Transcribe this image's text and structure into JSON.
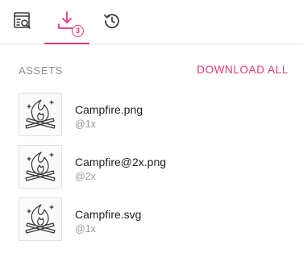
{
  "tabs": [
    {
      "icon": "inspect-icon"
    },
    {
      "icon": "download-icon",
      "badge": "3",
      "active": true
    },
    {
      "icon": "history-icon"
    }
  ],
  "accent_color": "#e2397a",
  "assets_section": {
    "title": "ASSETS",
    "download_all_label": "DOWNLOAD ALL"
  },
  "assets": [
    {
      "name": "Campfire.png",
      "scale": "@1x",
      "thumbnail_icon": "campfire-icon"
    },
    {
      "name": "Campfire@2x.png",
      "scale": "@2x",
      "thumbnail_icon": "campfire-icon"
    },
    {
      "name": "Campfire.svg",
      "scale": "@1x",
      "thumbnail_icon": "campfire-icon"
    }
  ]
}
